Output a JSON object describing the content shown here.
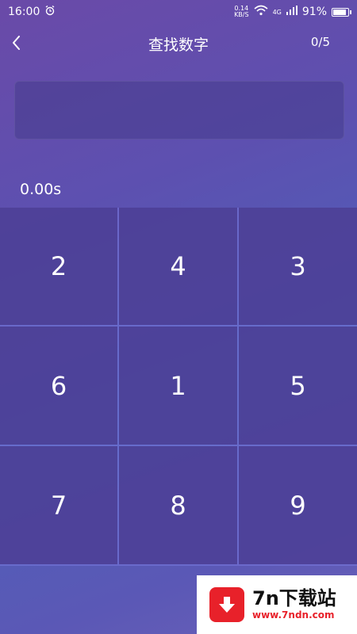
{
  "status_bar": {
    "time": "16:00",
    "net_speed_value": "0.14",
    "net_speed_unit": "KB/S",
    "network": "4G",
    "battery": "91%",
    "icons": [
      "alarm-icon",
      "wifi-icon",
      "signal-icon",
      "battery-icon"
    ]
  },
  "header": {
    "title": "查找数字",
    "progress": "0/5"
  },
  "timer": "0.00s",
  "keypad": {
    "keys": [
      "2",
      "4",
      "3",
      "6",
      "1",
      "5",
      "7",
      "8",
      "9"
    ]
  },
  "ad": {
    "name": "7n下载站",
    "url": "www.7ndn.com",
    "color": "#e8212a"
  }
}
